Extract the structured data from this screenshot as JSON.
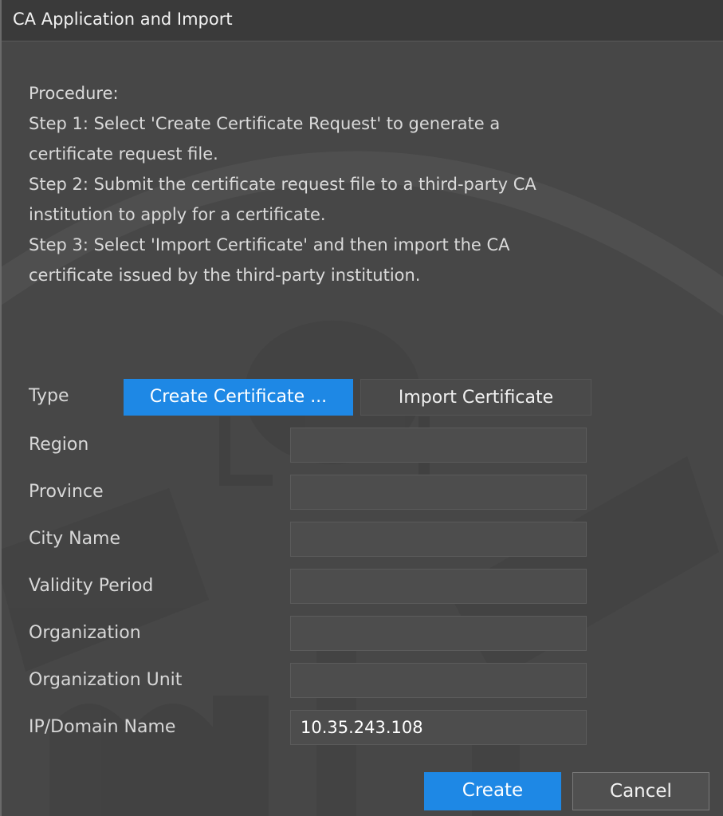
{
  "dialog": {
    "title": "CA Application and Import"
  },
  "procedure": {
    "heading": "Procedure:",
    "lines": [
      " Step 1: Select 'Create Certificate Request' to generate a",
      "certificate request file.",
      " Step 2: Submit the certificate request file to a third-party CA",
      "institution to apply for a certificate.",
      " Step 3: Select 'Import Certificate' and then import the CA",
      "certificate issued by the third-party institution."
    ]
  },
  "type": {
    "label": "Type",
    "options": [
      "Create Certificate ...",
      "Import Certificate"
    ],
    "selected": "Create Certificate ..."
  },
  "fields": [
    {
      "label": "Region",
      "value": ""
    },
    {
      "label": "Province",
      "value": ""
    },
    {
      "label": "City Name",
      "value": ""
    },
    {
      "label": "Validity Period",
      "value": ""
    },
    {
      "label": "Organization",
      "value": ""
    },
    {
      "label": "Organization Unit",
      "value": ""
    },
    {
      "label": "IP/Domain Name",
      "value": "10.35.243.108"
    }
  ],
  "buttons": {
    "create": "Create",
    "cancel": "Cancel"
  },
  "colors": {
    "accent": "#1e88e5",
    "panel": "#474747",
    "titlebar": "#3a3a3a"
  }
}
